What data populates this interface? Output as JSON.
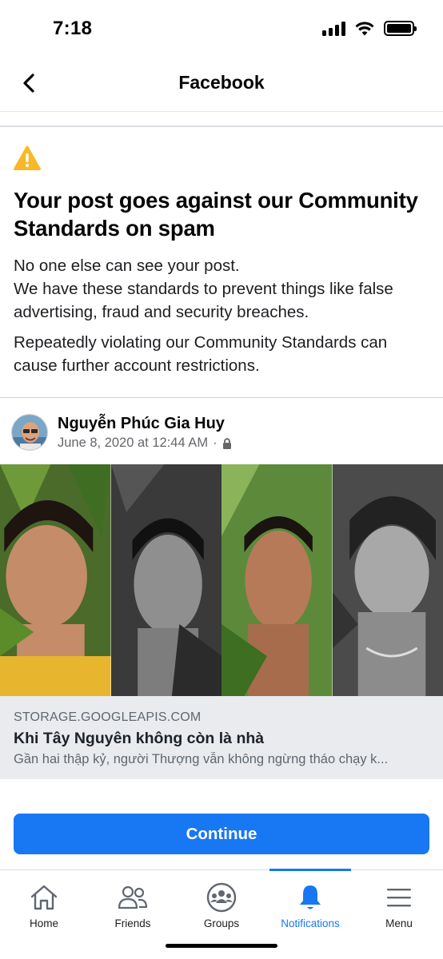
{
  "status_bar": {
    "time": "7:18"
  },
  "header": {
    "title": "Facebook"
  },
  "warning": {
    "title": "Your post goes against our Community Standards on spam",
    "paragraphs": [
      "No one else can see your post.\nWe have these standards to prevent things like false advertising, fraud and security breaches.",
      "Repeatedly violating our Community Standards can cause further account restrictions."
    ]
  },
  "post": {
    "author": "Nguyễn Phúc Gia Huy",
    "timestamp": "June 8, 2020 at 12:44 AM",
    "separator": "·",
    "privacy_icon": "lock-icon",
    "link": {
      "domain": "STORAGE.GOOGLEAPIS.COM",
      "title": "Khi Tây Nguyên không còn là nhà",
      "description": "Gần hai thập kỷ, người Thượng vẫn không ngừng tháo chạy k..."
    }
  },
  "actions": {
    "continue_label": "Continue"
  },
  "tabs": [
    {
      "label": "Home",
      "icon": "home-icon"
    },
    {
      "label": "Friends",
      "icon": "friends-icon"
    },
    {
      "label": "Groups",
      "icon": "groups-icon"
    },
    {
      "label": "Notifications",
      "icon": "bell-icon",
      "active": true
    },
    {
      "label": "Menu",
      "icon": "menu-icon"
    }
  ],
  "colors": {
    "accent": "#1877f2",
    "warning": "#f7b928",
    "link_bg": "#e9ebee"
  }
}
